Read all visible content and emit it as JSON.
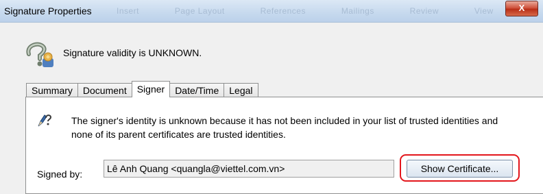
{
  "window": {
    "title": "Signature Properties",
    "close_label": "X",
    "ghost_menu": [
      "Insert",
      "Page Layout",
      "References",
      "Mailings",
      "Review",
      "View"
    ]
  },
  "status": {
    "icon": "signature-unknown-icon",
    "text": "Signature validity is UNKNOWN."
  },
  "tabs": [
    {
      "label": "Summary",
      "active": false
    },
    {
      "label": "Document",
      "active": false
    },
    {
      "label": "Signer",
      "active": true
    },
    {
      "label": "Date/Time",
      "active": false
    },
    {
      "label": "Legal",
      "active": false
    }
  ],
  "signer": {
    "icon": "pen-question-icon",
    "message": "The signer's identity is unknown because it has not been included in your list of trusted identities and none of its parent certificates are trusted identities.",
    "signed_by_label": "Signed by:",
    "signed_by_value": "Lê Anh Quang <quangla@viettel.com.vn>",
    "show_certificate_label": "Show Certificate...",
    "highlight_color": "#e3151b"
  }
}
